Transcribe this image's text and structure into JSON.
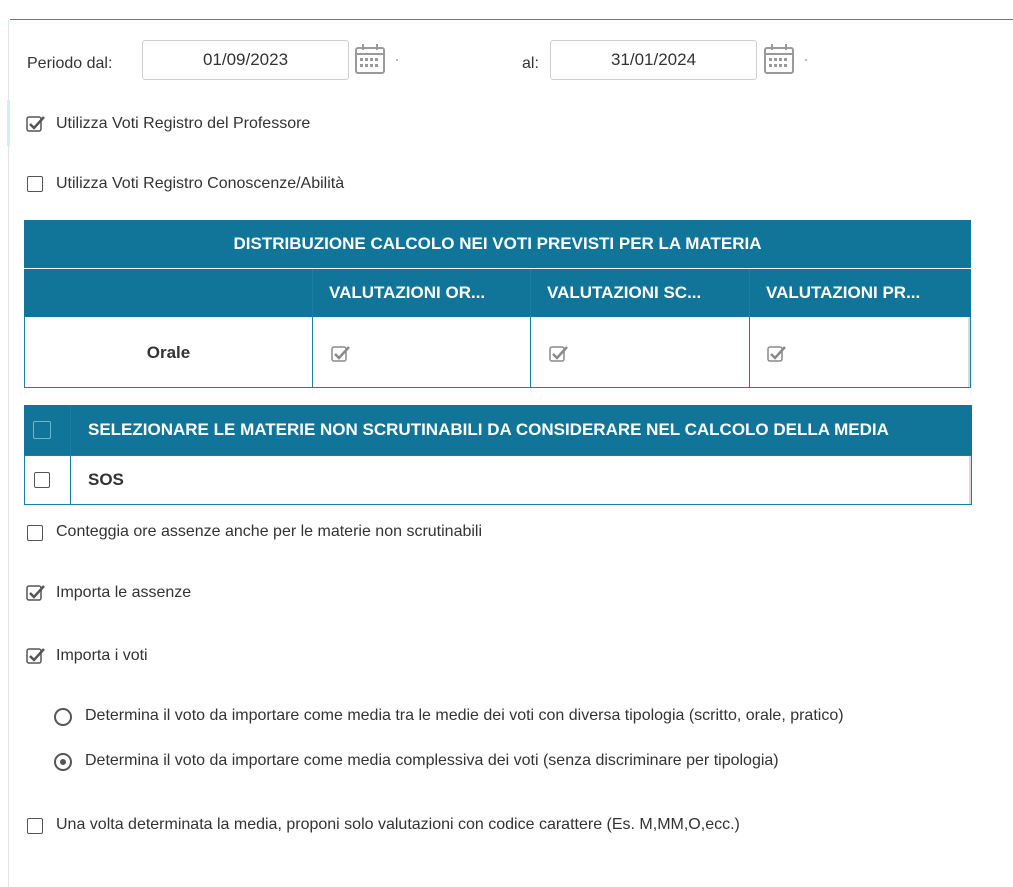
{
  "period": {
    "from_label": "Periodo dal:",
    "from_value": "01/09/2023",
    "to_label": "al:",
    "to_value": "31/01/2024"
  },
  "options": {
    "registro_professore": {
      "label": "Utilizza Voti Registro del Professore",
      "checked": true
    },
    "registro_conoscenze": {
      "label": "Utilizza Voti Registro Conoscenze/Abilità",
      "checked": false
    }
  },
  "distribution_table": {
    "title": "DISTRIBUZIONE CALCOLO NEI VOTI PREVISTI PER LA MATERIA",
    "columns": [
      "",
      "VALUTAZIONI OR...",
      "VALUTAZIONI SC...",
      "VALUTAZIONI PR..."
    ],
    "rows": [
      {
        "label": "Orale",
        "values": [
          true,
          true,
          true
        ]
      }
    ]
  },
  "non_scrutinabili_table": {
    "header": "SELEZIONARE LE MATERIE NON SCRUTINABILI DA CONSIDERARE NEL CALCOLO DELLA MEDIA",
    "rows": [
      {
        "label": "SOS",
        "checked": false
      }
    ]
  },
  "settings": {
    "conteggia_ore": {
      "label": "Conteggia ore assenze anche per le materie non scrutinabili",
      "checked": false
    },
    "importa_assenze": {
      "label": "Importa le assenze",
      "checked": true
    },
    "importa_voti": {
      "label": "Importa i voti",
      "checked": true
    },
    "radio_tipologia": {
      "label": "Determina il voto da importare come media tra le medie dei voti con diversa tipologia (scritto, orale, pratico)",
      "selected": false
    },
    "radio_complessiva": {
      "label": "Determina il voto da importare come media complessiva dei voti (senza discriminare per tipologia)",
      "selected": true
    },
    "solo_codice": {
      "label": "Una volta determinata la media, proponi solo valutazioni con codice carattere (Es. M,MM,O,ecc.)",
      "checked": false
    }
  },
  "colors": {
    "header_bg": "#11759a",
    "border": "#1a7fa6",
    "checkmark_gray": "#8a8a8a",
    "accent_line": "#2a93b5"
  }
}
